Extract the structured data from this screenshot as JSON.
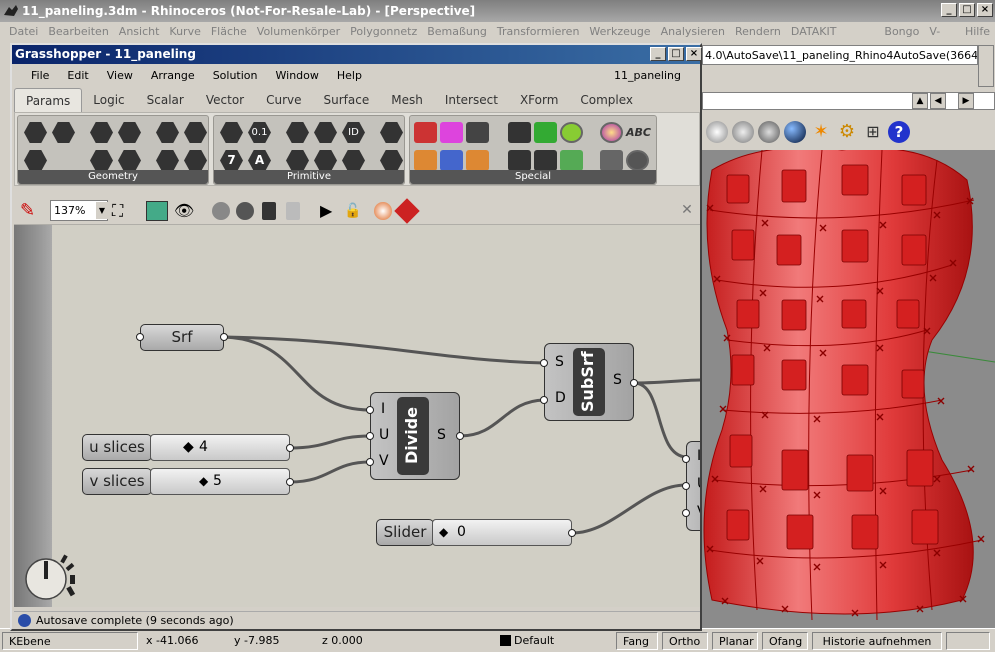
{
  "rhino": {
    "title": "11_paneling.3dm - Rhinoceros (Not-For-Resale-Lab) - [Perspective]",
    "menu": [
      "Datei",
      "Bearbeiten",
      "Ansicht",
      "Kurve",
      "Fläche",
      "Volumenkörper",
      "Polygonnetz",
      "Bemaßung",
      "Transformieren",
      "Werkzeuge",
      "Analysieren",
      "Rendern",
      "DATAKIT Exchange",
      "Bongo",
      "V-Ray",
      "Hilfe"
    ],
    "command_line": "4.0\\AutoSave\\11_paneling_Rhino4AutoSave(3664",
    "status": {
      "layer": "KEbene",
      "x": "x -41.066",
      "y": "y -7.985",
      "z": "z 0.000",
      "layer_default": "Default",
      "fang": "Fang",
      "ortho": "Ortho",
      "planar": "Planar",
      "ofang": "Ofang",
      "history": "Historie aufnehmen"
    }
  },
  "grasshopper": {
    "title": "Grasshopper - 11_paneling",
    "menu": [
      "File",
      "Edit",
      "View",
      "Arrange",
      "Solution",
      "Window",
      "Help"
    ],
    "document": "11_paneling",
    "tabs": [
      "Params",
      "Logic",
      "Scalar",
      "Vector",
      "Curve",
      "Surface",
      "Mesh",
      "Intersect",
      "XForm",
      "Complex"
    ],
    "active_tab": "Params",
    "groups": [
      "Geometry",
      "Primitive",
      "Special"
    ],
    "zoom": "137%",
    "status": "Autosave complete (9 seconds ago)",
    "ribbon_text": {
      "v01": "0.1",
      "id": "ID",
      "seven": "7",
      "a": "A",
      "abc": "ABC"
    },
    "components": {
      "srf": "Srf",
      "u_slices": "u slices",
      "u_value": "4",
      "v_slices": "v slices",
      "v_value": "5",
      "slider": "Slider",
      "slider_value": "0",
      "divide": {
        "name": "Divide",
        "inputs": [
          "I",
          "U",
          "V"
        ],
        "output": "S"
      },
      "subsrf": {
        "name": "SubSrf",
        "inputs": [
          "S",
          "D"
        ],
        "output": "S"
      },
      "partial_inputs": [
        "I",
        "U",
        "V"
      ]
    }
  }
}
